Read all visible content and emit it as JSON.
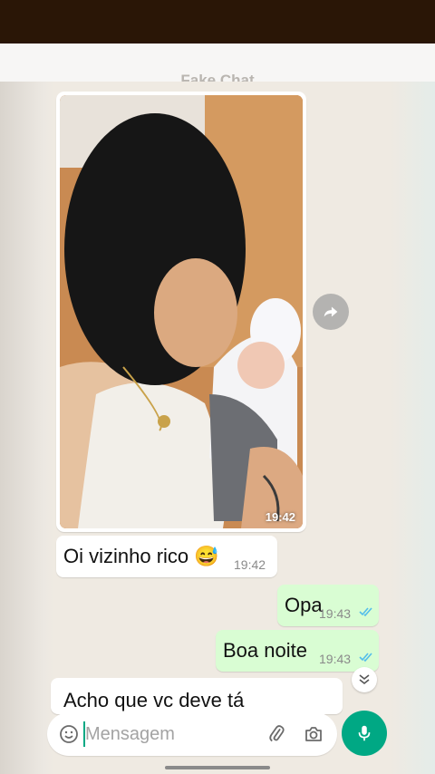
{
  "header": {
    "title": "Fake Chat"
  },
  "colors": {
    "outgoing_bubble": "#d9fdd3",
    "incoming_bubble": "#ffffff",
    "accent": "#00a884",
    "read_ticks": "#53bdeb"
  },
  "image_message": {
    "time": "19:42",
    "icon": "forward-icon"
  },
  "messages": [
    {
      "direction": "in",
      "text": "Oi vizinho rico 😅",
      "time": "19:42"
    },
    {
      "direction": "out",
      "text": "Opa",
      "time": "19:43",
      "status": "read"
    },
    {
      "direction": "out",
      "text": "Boa noite",
      "time": "19:43",
      "status": "read"
    },
    {
      "direction": "in",
      "text": "Acho que vc deve tá"
    }
  ],
  "composer": {
    "placeholder": "Mensagem",
    "value": "",
    "icons": [
      "emoji-icon",
      "attach-icon",
      "camera-icon",
      "mic-icon"
    ]
  }
}
